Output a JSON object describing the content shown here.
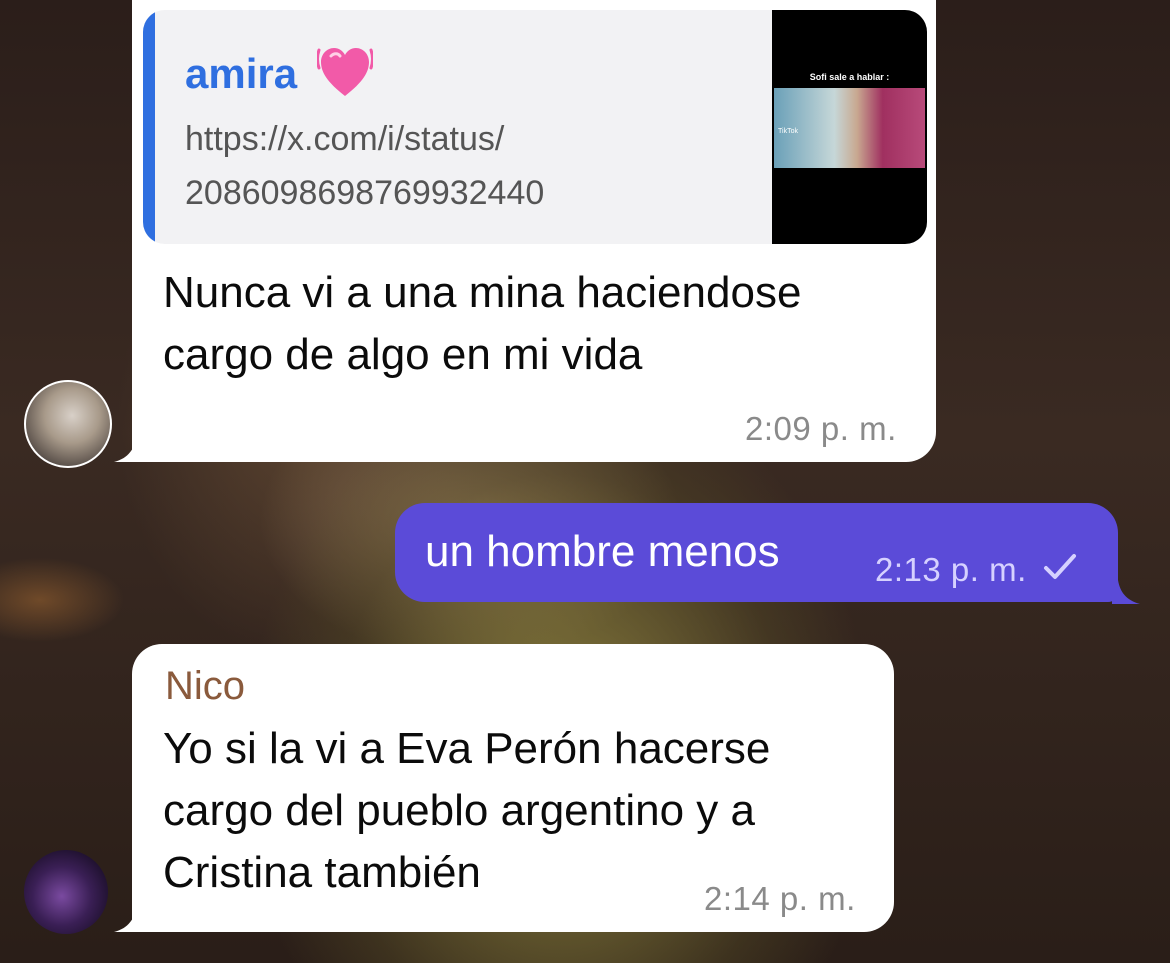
{
  "chat": {
    "messages": [
      {
        "direction": "incoming",
        "reply_preview": {
          "name": "amira",
          "emoji_icon": "beating-heart-icon",
          "text": "https://x.com/i/status/ 2086098698769932440",
          "thumbnail_caption": "Sofi sale a hablar :",
          "thumbnail_label": "TikTok"
        },
        "text": "Nunca vi a una mina haciendose cargo de algo en mi vida",
        "time": "2:09 p. m."
      },
      {
        "direction": "outgoing",
        "text": "un hombre menos",
        "time": "2:13 p. m.",
        "status_icon": "sent-check-icon"
      },
      {
        "direction": "incoming",
        "sender": "Nico",
        "text": "Yo si la vi a Eva Perón hacerse cargo del pueblo argentino y a Cristina también",
        "time": "2:14 p. m."
      }
    ]
  },
  "colors": {
    "outgoing_bubble": "#5b4bd8",
    "incoming_bubble": "#ffffff",
    "reply_accent": "#2f6fe0",
    "sender_name": "#8a5a3c"
  }
}
